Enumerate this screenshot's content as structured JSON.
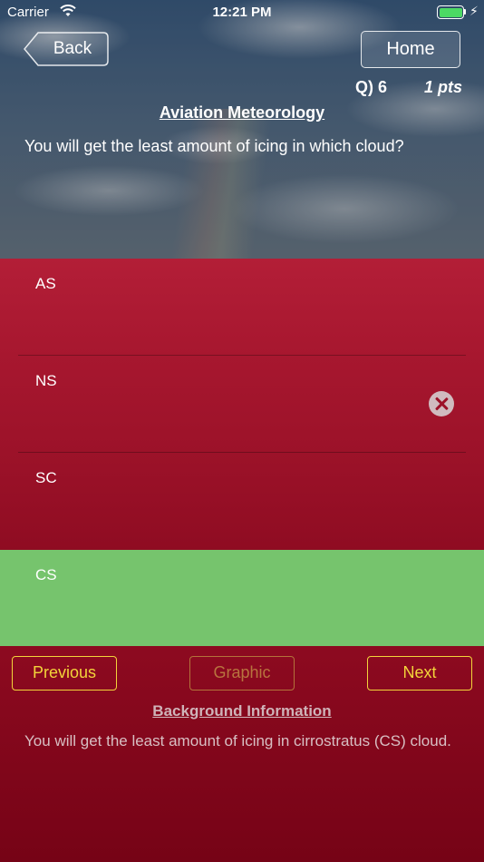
{
  "status_bar": {
    "carrier": "Carrier",
    "time": "12:21 PM",
    "battery_color": "#4cd964"
  },
  "nav": {
    "back_label": "Back",
    "home_label": "Home"
  },
  "question_info": {
    "number": "Q) 6",
    "points": "1 pts",
    "subject": "Aviation Meteorology",
    "text": "You will get the least amount of icing in which cloud?"
  },
  "answers": [
    {
      "label": "AS",
      "state": "neutral"
    },
    {
      "label": "NS",
      "state": "incorrect",
      "icon": "close-circle-icon"
    },
    {
      "label": "SC",
      "state": "neutral"
    },
    {
      "label": "CS",
      "state": "correct"
    }
  ],
  "controls": {
    "previous_label": "Previous",
    "graphic_label": "Graphic",
    "next_label": "Next"
  },
  "background": {
    "title": "Background Information",
    "text": "You will get the least amount of icing in cirrostratus (CS) cloud."
  },
  "colors": {
    "answer_red": "#a7172f",
    "correct_green": "#76c46d",
    "button_yellow": "#f3d43a"
  }
}
